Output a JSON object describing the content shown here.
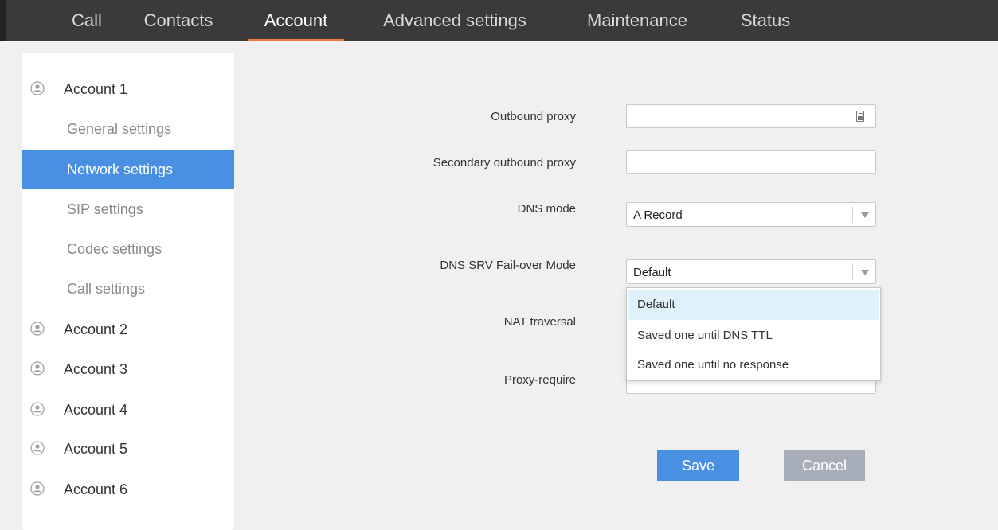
{
  "nav": {
    "tabs": [
      {
        "label": "Call"
      },
      {
        "label": "Contacts"
      },
      {
        "label": "Account"
      },
      {
        "label": "Advanced settings"
      },
      {
        "label": "Maintenance"
      },
      {
        "label": "Status"
      }
    ],
    "active": "Account"
  },
  "sidebar": {
    "account1": {
      "label": "Account 1"
    },
    "subitems": [
      {
        "label": "General settings"
      },
      {
        "label": "Network settings"
      },
      {
        "label": "SIP settings"
      },
      {
        "label": "Codec settings"
      },
      {
        "label": "Call settings"
      }
    ],
    "active_subitem": "Network settings",
    "other_accounts": [
      {
        "label": "Account 2"
      },
      {
        "label": "Account 3"
      },
      {
        "label": "Account 4"
      },
      {
        "label": "Account 5"
      },
      {
        "label": "Account 6"
      }
    ]
  },
  "form": {
    "outbound_proxy": {
      "label": "Outbound proxy",
      "value": ""
    },
    "secondary_outbound_proxy": {
      "label": "Secondary outbound proxy",
      "value": ""
    },
    "dns_mode": {
      "label": "DNS mode",
      "value": "A Record"
    },
    "dns_srv_failover": {
      "label": "DNS SRV Fail-over Mode",
      "value": "Default",
      "options": [
        "Default",
        "Saved one until DNS TTL",
        "Saved one until no response"
      ],
      "highlighted": "Default"
    },
    "nat_traversal": {
      "label": "NAT traversal"
    },
    "proxy_require": {
      "label": "Proxy-require",
      "value": ""
    }
  },
  "buttons": {
    "save": "Save",
    "cancel": "Cancel"
  },
  "colors": {
    "topbar": "#3a3a3a",
    "active_tab_underline": "#f07a3a",
    "primary": "#4a90e2",
    "cancel": "#a8aeb9",
    "dropdown_highlight": "#dff1f9"
  }
}
